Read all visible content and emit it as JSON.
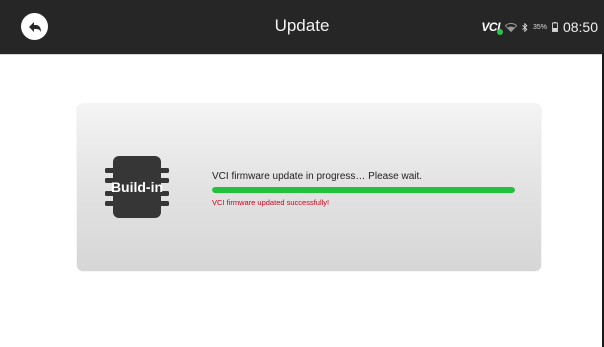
{
  "header": {
    "title": "Update",
    "back_icon": "back-arrow-icon",
    "status": {
      "vci_label": "VCI",
      "vci_connected_color": "#2ec24a",
      "wifi_icon": "wifi-icon",
      "bluetooth_icon": "bluetooth-icon",
      "battery_percent": "35%",
      "battery_icon": "battery-icon",
      "time": "08:50"
    }
  },
  "update_panel": {
    "chip_label": "Build-in",
    "chip_icon": "chip-icon",
    "message": "VCI firmware update in progress… Please wait.",
    "progress": 1.0,
    "progress_color": "#22c03c",
    "status_message": "VCI firmware updated successfully!",
    "status_color": "#d0021b"
  }
}
